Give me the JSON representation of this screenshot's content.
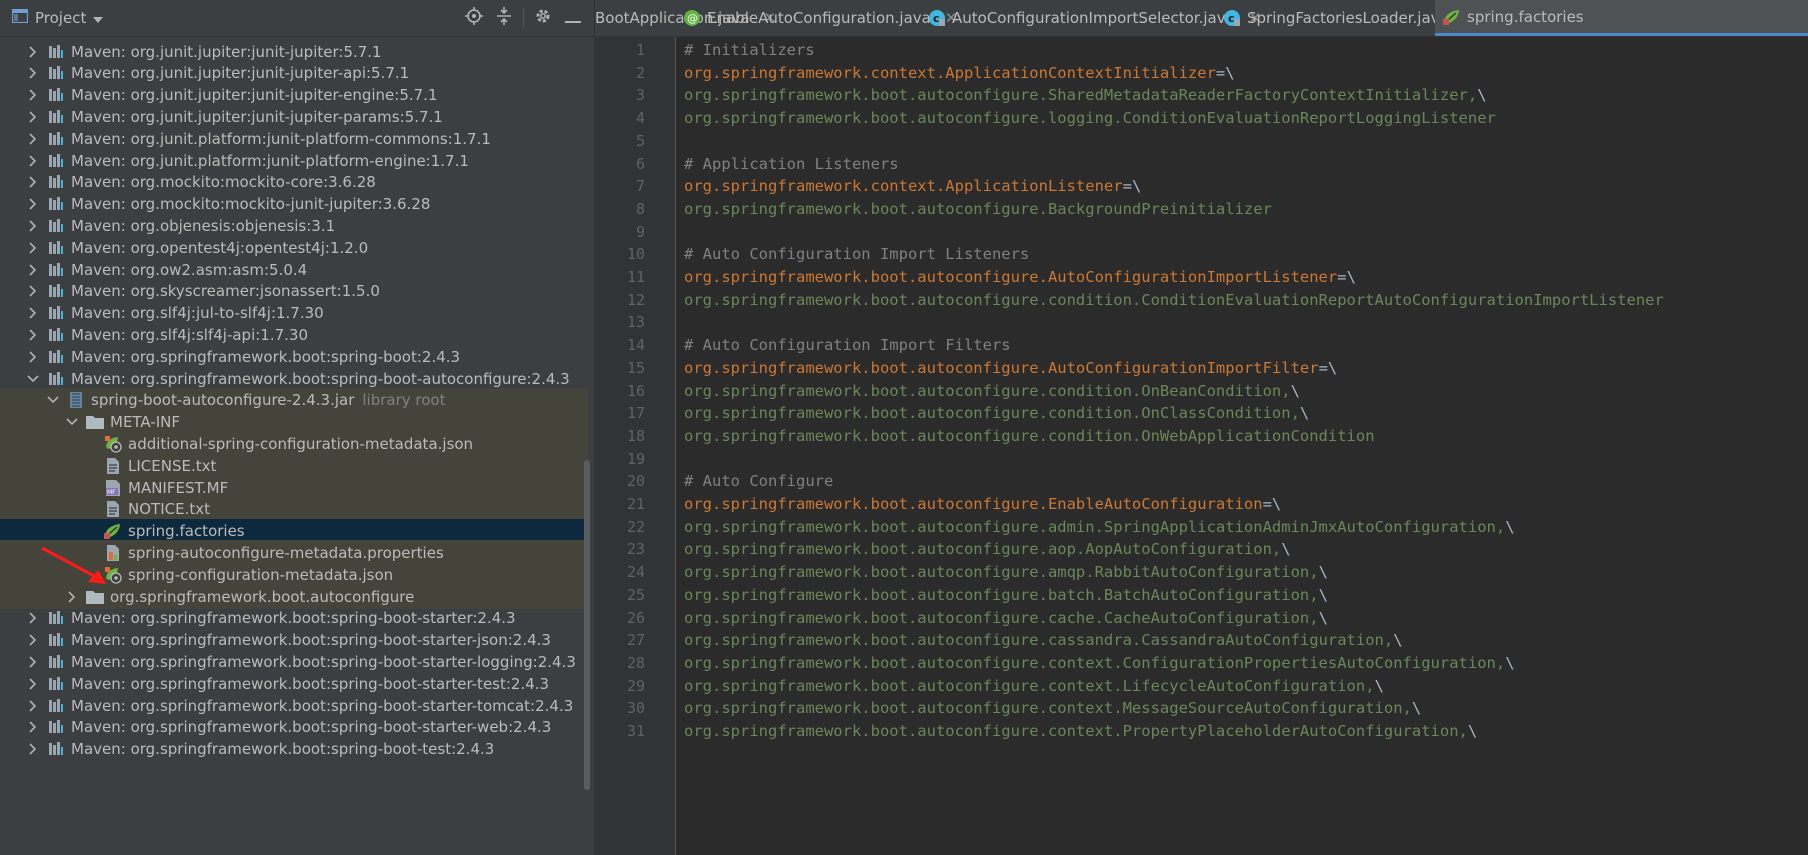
{
  "project_panel": {
    "title": "Project",
    "tools": [
      "crosshair-icon",
      "collapse-icon",
      "gear-icon",
      "minimize-icon"
    ]
  },
  "tree": [
    {
      "label": "Maven: org.junit.jupiter:junit-jupiter:5.7.1",
      "depth": 1,
      "expanded": false,
      "icon": "library-icon"
    },
    {
      "label": "Maven: org.junit.jupiter:junit-jupiter-api:5.7.1",
      "depth": 1,
      "expanded": false,
      "icon": "library-icon"
    },
    {
      "label": "Maven: org.junit.jupiter:junit-jupiter-engine:5.7.1",
      "depth": 1,
      "expanded": false,
      "icon": "library-icon"
    },
    {
      "label": "Maven: org.junit.jupiter:junit-jupiter-params:5.7.1",
      "depth": 1,
      "expanded": false,
      "icon": "library-icon"
    },
    {
      "label": "Maven: org.junit.platform:junit-platform-commons:1.7.1",
      "depth": 1,
      "expanded": false,
      "icon": "library-icon"
    },
    {
      "label": "Maven: org.junit.platform:junit-platform-engine:1.7.1",
      "depth": 1,
      "expanded": false,
      "icon": "library-icon"
    },
    {
      "label": "Maven: org.mockito:mockito-core:3.6.28",
      "depth": 1,
      "expanded": false,
      "icon": "library-icon"
    },
    {
      "label": "Maven: org.mockito:mockito-junit-jupiter:3.6.28",
      "depth": 1,
      "expanded": false,
      "icon": "library-icon"
    },
    {
      "label": "Maven: org.objenesis:objenesis:3.1",
      "depth": 1,
      "expanded": false,
      "icon": "library-icon"
    },
    {
      "label": "Maven: org.opentest4j:opentest4j:1.2.0",
      "depth": 1,
      "expanded": false,
      "icon": "library-icon"
    },
    {
      "label": "Maven: org.ow2.asm:asm:5.0.4",
      "depth": 1,
      "expanded": false,
      "icon": "library-icon"
    },
    {
      "label": "Maven: org.skyscreamer:jsonassert:1.5.0",
      "depth": 1,
      "expanded": false,
      "icon": "library-icon"
    },
    {
      "label": "Maven: org.slf4j:jul-to-slf4j:1.7.30",
      "depth": 1,
      "expanded": false,
      "icon": "library-icon"
    },
    {
      "label": "Maven: org.slf4j:slf4j-api:1.7.30",
      "depth": 1,
      "expanded": false,
      "icon": "library-icon"
    },
    {
      "label": "Maven: org.springframework.boot:spring-boot:2.4.3",
      "depth": 1,
      "expanded": false,
      "icon": "library-icon"
    },
    {
      "label": "Maven: org.springframework.boot:spring-boot-autoconfigure:2.4.3",
      "depth": 1,
      "expanded": true,
      "icon": "library-icon"
    },
    {
      "label": "spring-boot-autoconfigure-2.4.3.jar",
      "tag": "library root",
      "depth": 2,
      "expanded": true,
      "icon": "jar-icon",
      "lib": true
    },
    {
      "label": "META-INF",
      "depth": 3,
      "expanded": true,
      "icon": "folder-icon",
      "lib": true
    },
    {
      "label": "additional-spring-configuration-metadata.json",
      "depth": 4,
      "icon": "spring-json-icon",
      "lib": true
    },
    {
      "label": "LICENSE.txt",
      "depth": 4,
      "icon": "text-file-icon",
      "lib": true
    },
    {
      "label": "MANIFEST.MF",
      "depth": 4,
      "icon": "manifest-icon",
      "lib": true
    },
    {
      "label": "NOTICE.txt",
      "depth": 4,
      "icon": "text-file-icon",
      "lib": true
    },
    {
      "label": "spring.factories",
      "depth": 4,
      "icon": "spring-factories-icon",
      "selected": true
    },
    {
      "label": "spring-autoconfigure-metadata.properties",
      "depth": 4,
      "icon": "properties-file-icon",
      "lib": true
    },
    {
      "label": "spring-configuration-metadata.json",
      "depth": 4,
      "icon": "spring-json-icon",
      "lib": true
    },
    {
      "label": "org.springframework.boot.autoconfigure",
      "depth": 3,
      "expanded": false,
      "icon": "folder-icon",
      "lib": true
    },
    {
      "label": "Maven: org.springframework.boot:spring-boot-starter:2.4.3",
      "depth": 1,
      "expanded": false,
      "icon": "library-icon"
    },
    {
      "label": "Maven: org.springframework.boot:spring-boot-starter-json:2.4.3",
      "depth": 1,
      "expanded": false,
      "icon": "library-icon"
    },
    {
      "label": "Maven: org.springframework.boot:spring-boot-starter-logging:2.4.3",
      "depth": 1,
      "expanded": false,
      "icon": "library-icon"
    },
    {
      "label": "Maven: org.springframework.boot:spring-boot-starter-test:2.4.3",
      "depth": 1,
      "expanded": false,
      "icon": "library-icon"
    },
    {
      "label": "Maven: org.springframework.boot:spring-boot-starter-tomcat:2.4.3",
      "depth": 1,
      "expanded": false,
      "icon": "library-icon"
    },
    {
      "label": "Maven: org.springframework.boot:spring-boot-starter-web:2.4.3",
      "depth": 1,
      "expanded": false,
      "icon": "library-icon"
    },
    {
      "label": "Maven: org.springframework.boot:spring-boot-test:2.4.3",
      "depth": 1,
      "expanded": false,
      "icon": "library-icon"
    }
  ],
  "tabs": [
    {
      "label": "BootApplication.java",
      "icon": "",
      "active": false
    },
    {
      "label": "EnableAutoConfiguration.java",
      "icon": "annotation-icon",
      "active": false
    },
    {
      "label": "AutoConfigurationImportSelector.java",
      "icon": "class-icon",
      "active": false
    },
    {
      "label": "SpringFactoriesLoader.java",
      "icon": "class-icon",
      "active": false
    },
    {
      "label": "spring.factories",
      "icon": "spring-factories-icon",
      "active": true
    }
  ],
  "code_lines": [
    {
      "n": 1,
      "type": "comment",
      "text": "# Initializers"
    },
    {
      "n": 2,
      "type": "key",
      "text": "org.springframework.context.ApplicationContextInitializer",
      "suffix": "=\\"
    },
    {
      "n": 3,
      "type": "val",
      "text": "org.springframework.boot.autoconfigure.SharedMetadataReaderFactoryContextInitializer,",
      "suffix": "\\"
    },
    {
      "n": 4,
      "type": "val",
      "text": "org.springframework.boot.autoconfigure.logging.ConditionEvaluationReportLoggingListener",
      "suffix": ""
    },
    {
      "n": 5,
      "type": "blank",
      "text": ""
    },
    {
      "n": 6,
      "type": "comment",
      "text": "# Application Listeners"
    },
    {
      "n": 7,
      "type": "key",
      "text": "org.springframework.context.ApplicationListener",
      "suffix": "=\\"
    },
    {
      "n": 8,
      "type": "val",
      "text": "org.springframework.boot.autoconfigure.BackgroundPreinitializer",
      "suffix": ""
    },
    {
      "n": 9,
      "type": "blank",
      "text": ""
    },
    {
      "n": 10,
      "type": "comment",
      "text": "# Auto Configuration Import Listeners"
    },
    {
      "n": 11,
      "type": "key",
      "text": "org.springframework.boot.autoconfigure.AutoConfigurationImportListener",
      "suffix": "=\\"
    },
    {
      "n": 12,
      "type": "val",
      "text": "org.springframework.boot.autoconfigure.condition.ConditionEvaluationReportAutoConfigurationImportListener",
      "suffix": ""
    },
    {
      "n": 13,
      "type": "blank",
      "text": ""
    },
    {
      "n": 14,
      "type": "comment",
      "text": "# Auto Configuration Import Filters"
    },
    {
      "n": 15,
      "type": "key",
      "text": "org.springframework.boot.autoconfigure.AutoConfigurationImportFilter",
      "suffix": "=\\"
    },
    {
      "n": 16,
      "type": "val",
      "text": "org.springframework.boot.autoconfigure.condition.OnBeanCondition,",
      "suffix": "\\"
    },
    {
      "n": 17,
      "type": "val",
      "text": "org.springframework.boot.autoconfigure.condition.OnClassCondition,",
      "suffix": "\\"
    },
    {
      "n": 18,
      "type": "val",
      "text": "org.springframework.boot.autoconfigure.condition.OnWebApplicationCondition",
      "suffix": ""
    },
    {
      "n": 19,
      "type": "blank",
      "text": ""
    },
    {
      "n": 20,
      "type": "comment",
      "text": "# Auto Configure"
    },
    {
      "n": 21,
      "type": "key",
      "text": "org.springframework.boot.autoconfigure.EnableAutoConfiguration",
      "suffix": "=\\"
    },
    {
      "n": 22,
      "type": "val",
      "text": "org.springframework.boot.autoconfigure.admin.SpringApplicationAdminJmxAutoConfiguration,",
      "suffix": "\\"
    },
    {
      "n": 23,
      "type": "val",
      "text": "org.springframework.boot.autoconfigure.aop.AopAutoConfiguration,",
      "suffix": "\\"
    },
    {
      "n": 24,
      "type": "val",
      "text": "org.springframework.boot.autoconfigure.amqp.RabbitAutoConfiguration,",
      "suffix": "\\"
    },
    {
      "n": 25,
      "type": "val",
      "text": "org.springframework.boot.autoconfigure.batch.BatchAutoConfiguration,",
      "suffix": "\\"
    },
    {
      "n": 26,
      "type": "val",
      "text": "org.springframework.boot.autoconfigure.cache.CacheAutoConfiguration,",
      "suffix": "\\"
    },
    {
      "n": 27,
      "type": "val",
      "text": "org.springframework.boot.autoconfigure.cassandra.CassandraAutoConfiguration,",
      "suffix": "\\"
    },
    {
      "n": 28,
      "type": "val",
      "text": "org.springframework.boot.autoconfigure.context.ConfigurationPropertiesAutoConfiguration,",
      "suffix": "\\"
    },
    {
      "n": 29,
      "type": "val",
      "text": "org.springframework.boot.autoconfigure.context.LifecycleAutoConfiguration,",
      "suffix": "\\"
    },
    {
      "n": 30,
      "type": "val",
      "text": "org.springframework.boot.autoconfigure.context.MessageSourceAutoConfiguration,",
      "suffix": "\\"
    },
    {
      "n": 31,
      "type": "val",
      "text": "org.springframework.boot.autoconfigure.context.PropertyPlaceholderAutoConfiguration,",
      "suffix": "\\"
    }
  ],
  "colors": {
    "panel_bg": "#3c3f41",
    "editor_bg": "#2b2b2b",
    "selection": "#0d293e",
    "library_bg": "#45443a",
    "comment": "#808080",
    "key": "#cc7832",
    "value": "#6a8759",
    "annotation_arrow": "#ff1a1a"
  }
}
